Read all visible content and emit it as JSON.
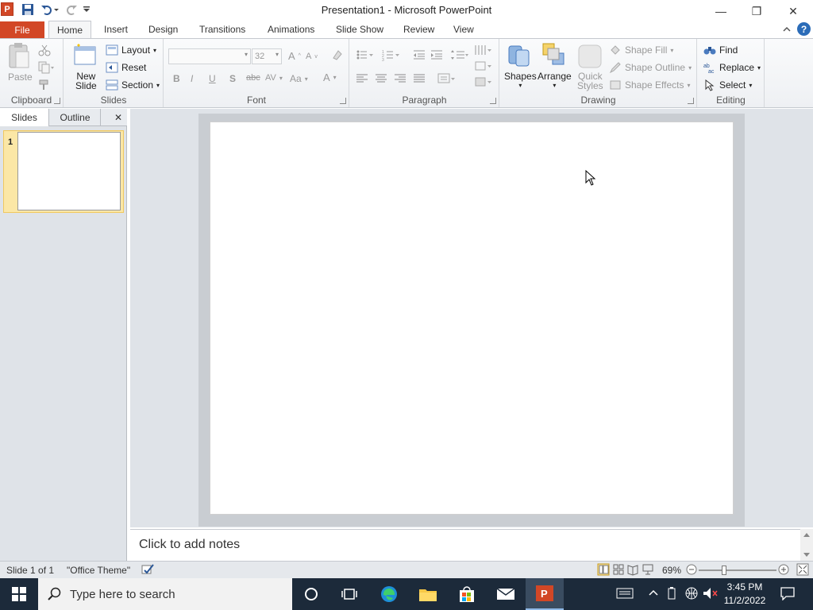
{
  "window": {
    "title": "Presentation1 - Microsoft PowerPoint",
    "app_icon_letter": "P",
    "minimize": "—",
    "restore": "❐",
    "close": "✕"
  },
  "tabs": {
    "file": "File",
    "home": "Home",
    "insert": "Insert",
    "design": "Design",
    "transitions": "Transitions",
    "animations": "Animations",
    "slide_show": "Slide Show",
    "review": "Review",
    "view": "View"
  },
  "ribbon": {
    "clipboard": {
      "label": "Clipboard",
      "paste": "Paste"
    },
    "slides": {
      "label": "Slides",
      "new_slide_1": "New",
      "new_slide_2": "Slide",
      "layout": "Layout",
      "reset": "Reset",
      "section": "Section"
    },
    "font": {
      "label": "Font",
      "size": "32",
      "bold": "B",
      "italic": "I",
      "underline": "U",
      "shadow": "S",
      "strike": "abc",
      "spacing": "AV",
      "case": "Aa",
      "color": "A",
      "grow": "A",
      "shrink": "A"
    },
    "paragraph": {
      "label": "Paragraph"
    },
    "drawing": {
      "label": "Drawing",
      "shapes": "Shapes",
      "arrange": "Arrange",
      "quick_styles_1": "Quick",
      "quick_styles_2": "Styles",
      "shape_fill": "Shape Fill",
      "shape_outline": "Shape Outline",
      "shape_effects": "Shape Effects"
    },
    "editing": {
      "label": "Editing",
      "find": "Find",
      "replace": "Replace",
      "select": "Select"
    }
  },
  "left_panel": {
    "slides_tab": "Slides",
    "outline_tab": "Outline",
    "close": "✕",
    "thumb_number": "1"
  },
  "notes": {
    "placeholder": "Click to add notes"
  },
  "status": {
    "slide_info": "Slide 1 of 1",
    "theme": "\"Office Theme\"",
    "zoom": "69%",
    "zoom_level": 0.69
  },
  "taskbar": {
    "search_placeholder": "Type here to search",
    "time": "3:45 PM",
    "date": "11/2/2022"
  },
  "colors": {
    "accent": "#d24726",
    "ribbon_bg": "#eef0f3",
    "taskbar": "#1c2a3a"
  }
}
